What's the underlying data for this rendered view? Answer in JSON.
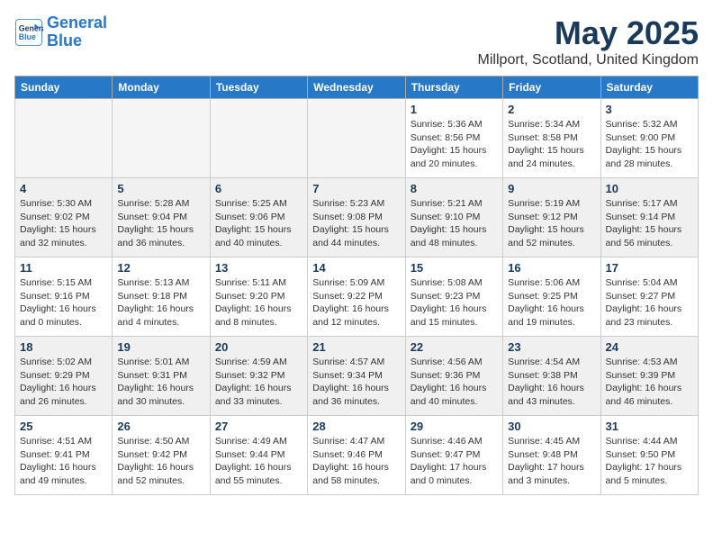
{
  "header": {
    "logo_line1": "General",
    "logo_line2": "Blue",
    "month": "May 2025",
    "location": "Millport, Scotland, United Kingdom"
  },
  "weekdays": [
    "Sunday",
    "Monday",
    "Tuesday",
    "Wednesday",
    "Thursday",
    "Friday",
    "Saturday"
  ],
  "weeks": [
    [
      {
        "day": "",
        "info": ""
      },
      {
        "day": "",
        "info": ""
      },
      {
        "day": "",
        "info": ""
      },
      {
        "day": "",
        "info": ""
      },
      {
        "day": "1",
        "info": "Sunrise: 5:36 AM\nSunset: 8:56 PM\nDaylight: 15 hours\nand 20 minutes."
      },
      {
        "day": "2",
        "info": "Sunrise: 5:34 AM\nSunset: 8:58 PM\nDaylight: 15 hours\nand 24 minutes."
      },
      {
        "day": "3",
        "info": "Sunrise: 5:32 AM\nSunset: 9:00 PM\nDaylight: 15 hours\nand 28 minutes."
      }
    ],
    [
      {
        "day": "4",
        "info": "Sunrise: 5:30 AM\nSunset: 9:02 PM\nDaylight: 15 hours\nand 32 minutes."
      },
      {
        "day": "5",
        "info": "Sunrise: 5:28 AM\nSunset: 9:04 PM\nDaylight: 15 hours\nand 36 minutes."
      },
      {
        "day": "6",
        "info": "Sunrise: 5:25 AM\nSunset: 9:06 PM\nDaylight: 15 hours\nand 40 minutes."
      },
      {
        "day": "7",
        "info": "Sunrise: 5:23 AM\nSunset: 9:08 PM\nDaylight: 15 hours\nand 44 minutes."
      },
      {
        "day": "8",
        "info": "Sunrise: 5:21 AM\nSunset: 9:10 PM\nDaylight: 15 hours\nand 48 minutes."
      },
      {
        "day": "9",
        "info": "Sunrise: 5:19 AM\nSunset: 9:12 PM\nDaylight: 15 hours\nand 52 minutes."
      },
      {
        "day": "10",
        "info": "Sunrise: 5:17 AM\nSunset: 9:14 PM\nDaylight: 15 hours\nand 56 minutes."
      }
    ],
    [
      {
        "day": "11",
        "info": "Sunrise: 5:15 AM\nSunset: 9:16 PM\nDaylight: 16 hours\nand 0 minutes."
      },
      {
        "day": "12",
        "info": "Sunrise: 5:13 AM\nSunset: 9:18 PM\nDaylight: 16 hours\nand 4 minutes."
      },
      {
        "day": "13",
        "info": "Sunrise: 5:11 AM\nSunset: 9:20 PM\nDaylight: 16 hours\nand 8 minutes."
      },
      {
        "day": "14",
        "info": "Sunrise: 5:09 AM\nSunset: 9:22 PM\nDaylight: 16 hours\nand 12 minutes."
      },
      {
        "day": "15",
        "info": "Sunrise: 5:08 AM\nSunset: 9:23 PM\nDaylight: 16 hours\nand 15 minutes."
      },
      {
        "day": "16",
        "info": "Sunrise: 5:06 AM\nSunset: 9:25 PM\nDaylight: 16 hours\nand 19 minutes."
      },
      {
        "day": "17",
        "info": "Sunrise: 5:04 AM\nSunset: 9:27 PM\nDaylight: 16 hours\nand 23 minutes."
      }
    ],
    [
      {
        "day": "18",
        "info": "Sunrise: 5:02 AM\nSunset: 9:29 PM\nDaylight: 16 hours\nand 26 minutes."
      },
      {
        "day": "19",
        "info": "Sunrise: 5:01 AM\nSunset: 9:31 PM\nDaylight: 16 hours\nand 30 minutes."
      },
      {
        "day": "20",
        "info": "Sunrise: 4:59 AM\nSunset: 9:32 PM\nDaylight: 16 hours\nand 33 minutes."
      },
      {
        "day": "21",
        "info": "Sunrise: 4:57 AM\nSunset: 9:34 PM\nDaylight: 16 hours\nand 36 minutes."
      },
      {
        "day": "22",
        "info": "Sunrise: 4:56 AM\nSunset: 9:36 PM\nDaylight: 16 hours\nand 40 minutes."
      },
      {
        "day": "23",
        "info": "Sunrise: 4:54 AM\nSunset: 9:38 PM\nDaylight: 16 hours\nand 43 minutes."
      },
      {
        "day": "24",
        "info": "Sunrise: 4:53 AM\nSunset: 9:39 PM\nDaylight: 16 hours\nand 46 minutes."
      }
    ],
    [
      {
        "day": "25",
        "info": "Sunrise: 4:51 AM\nSunset: 9:41 PM\nDaylight: 16 hours\nand 49 minutes."
      },
      {
        "day": "26",
        "info": "Sunrise: 4:50 AM\nSunset: 9:42 PM\nDaylight: 16 hours\nand 52 minutes."
      },
      {
        "day": "27",
        "info": "Sunrise: 4:49 AM\nSunset: 9:44 PM\nDaylight: 16 hours\nand 55 minutes."
      },
      {
        "day": "28",
        "info": "Sunrise: 4:47 AM\nSunset: 9:46 PM\nDaylight: 16 hours\nand 58 minutes."
      },
      {
        "day": "29",
        "info": "Sunrise: 4:46 AM\nSunset: 9:47 PM\nDaylight: 17 hours\nand 0 minutes."
      },
      {
        "day": "30",
        "info": "Sunrise: 4:45 AM\nSunset: 9:48 PM\nDaylight: 17 hours\nand 3 minutes."
      },
      {
        "day": "31",
        "info": "Sunrise: 4:44 AM\nSunset: 9:50 PM\nDaylight: 17 hours\nand 5 minutes."
      }
    ]
  ]
}
